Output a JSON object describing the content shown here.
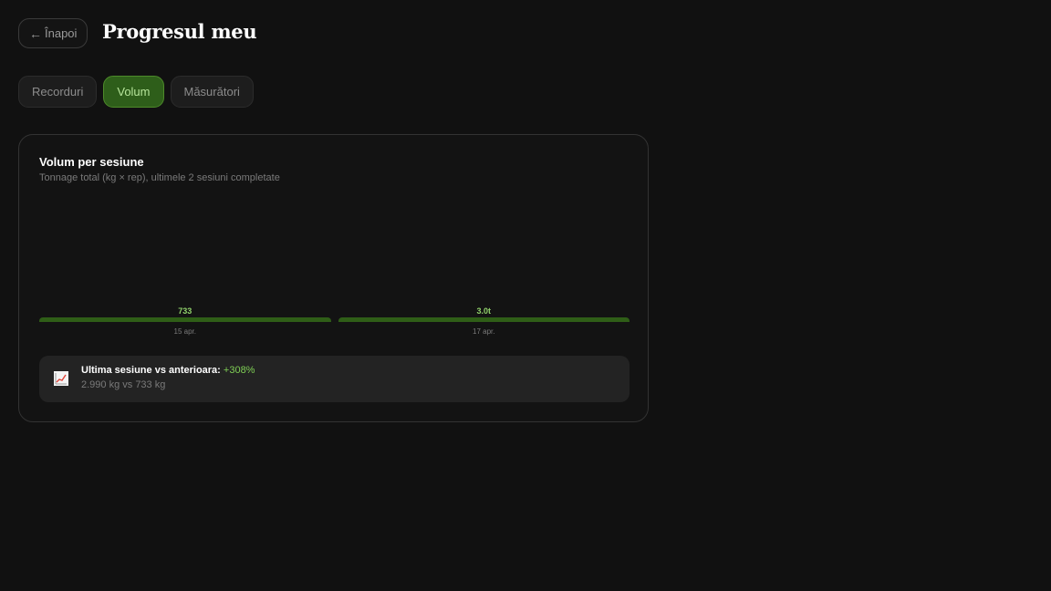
{
  "header": {
    "back_label": "Înapoi",
    "title": "Progresul meu"
  },
  "tabs": [
    {
      "label": "Recorduri",
      "active": false
    },
    {
      "label": "Volum",
      "active": true
    },
    {
      "label": "Măsurători",
      "active": false
    }
  ],
  "card": {
    "title": "Volum per sesiune",
    "subtitle": "Tonnage total (kg × rep), ultimele 2 sesiuni completate"
  },
  "chart_data": {
    "type": "bar",
    "categories": [
      "15 apr.",
      "17 apr."
    ],
    "values": [
      733,
      2990
    ],
    "value_labels": [
      "733",
      "3.0t"
    ],
    "ylabel": "",
    "xlabel": ""
  },
  "comparison": {
    "icon": "chart-increasing-icon",
    "label": "Ultima sesiune vs anterioara:",
    "change": "+308%",
    "detail": "2.990 kg vs 733 kg"
  },
  "colors": {
    "background": "#111111",
    "accent": "#2e5e1a",
    "accent_text": "#8fcf6a",
    "positive": "#7fcf55"
  }
}
